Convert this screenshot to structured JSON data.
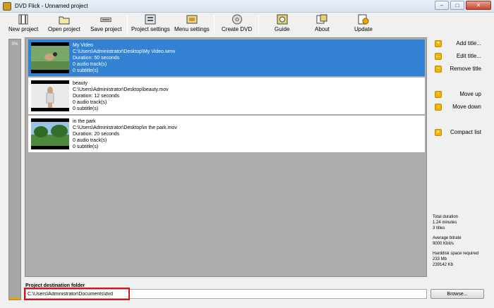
{
  "window": {
    "title": "DVD Flick - Unnamed project",
    "minimize": "–",
    "maximize": "□",
    "close": "✕"
  },
  "toolbar": {
    "new_project": "New project",
    "open_project": "Open project",
    "save_project": "Save project",
    "project_settings": "Project settings",
    "menu_settings": "Menu settings",
    "create_dvd": "Create DVD",
    "guide": "Guide",
    "about": "About",
    "update": "Update"
  },
  "progress": {
    "label": "0%",
    "value": 0
  },
  "titles": [
    {
      "name": "My Video",
      "path": "C:\\Users\\Administrator\\Desktop\\My Video.wmv",
      "duration": "Duration: 50 seconds",
      "audio": "0 audio track(s)",
      "subtitles": "0 subtitle(s)"
    },
    {
      "name": "beauty",
      "path": "C:\\Users\\Administrator\\Desktop\\beauty.mov",
      "duration": "Duration: 12 seconds",
      "audio": "0 audio track(s)",
      "subtitles": "0 subtitle(s)"
    },
    {
      "name": "in the park",
      "path": "C:\\Users\\Administrator\\Desktop\\in the park.mov",
      "duration": "Duration: 20 seconds",
      "audio": "0 audio track(s)",
      "subtitles": "0 subtitle(s)"
    }
  ],
  "side": {
    "add_title": "Add title...",
    "edit_title": "Edit title...",
    "remove_title": "Remove title",
    "move_up": "Move up",
    "move_down": "Move down",
    "compact_list": "Compact list"
  },
  "stats": {
    "total_duration_label": "Total duration",
    "total_duration_minutes": "1.24 minutes",
    "total_titles": "3 titles",
    "avg_bitrate_label": "Average bitrate",
    "avg_bitrate_value": "9000 Kbit/s",
    "harddisk_label": "Harddisk space required",
    "harddisk_mb": "233 Mb",
    "harddisk_kb": "239142 Kb"
  },
  "destination": {
    "label": "Project destination folder",
    "value": "C:\\Users\\Administrator\\Documents\\dvd",
    "browse": "Browse..."
  },
  "colors": {
    "selected": "#3281d3",
    "list_bg": "#acacac",
    "accent": "#f0b400",
    "highlight": "#d2151b"
  }
}
